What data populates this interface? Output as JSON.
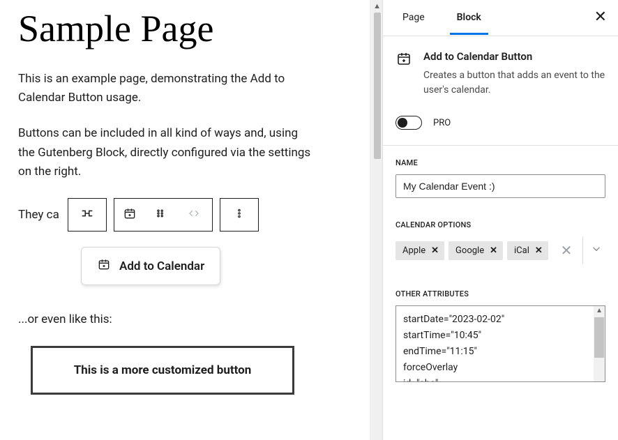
{
  "editor": {
    "page_title": "Sample Page",
    "para1": "This is an example page, demonstrating the Add to Calendar Button usage.",
    "para2": "Buttons can be included in all kind of ways and, using the Gutenberg Block, directly configured via the settings on the right.",
    "para3_prefix": "They ca",
    "atcb_label": "Add to Calendar",
    "para4": "...or even like this:",
    "custom_button_label": "This is a more customized button"
  },
  "sidebar": {
    "tabs": {
      "page": "Page",
      "block": "Block"
    },
    "block_title": "Add to Calendar Button",
    "block_desc": "Creates a button that adds an event to the user's calendar.",
    "pro_label": "PRO",
    "sections": {
      "name_label": "NAME",
      "name_value": "My Calendar Event :)",
      "cal_opts_label": "CALENDAR OPTIONS",
      "cal_chips": [
        "Apple",
        "Google",
        "iCal"
      ],
      "other_attrs_label": "OTHER ATTRIBUTES",
      "other_attrs_text": "startDate=\"2023-02-02\"\nstartTime=\"10:45\"\nendTime=\"11:15\"\nforceOverlay\nid=\"abc\""
    }
  }
}
